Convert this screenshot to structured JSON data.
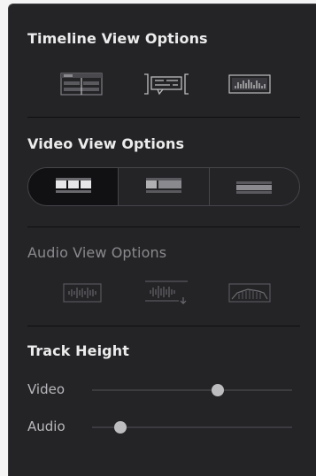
{
  "timeline_view": {
    "title": "Timeline View Options",
    "buttons": [
      {
        "icon": "stacked-timelines-icon"
      },
      {
        "icon": "subtitle-track-icon"
      },
      {
        "icon": "audio-waveform-track-icon"
      }
    ]
  },
  "video_view": {
    "title": "Video View Options",
    "options": [
      {
        "icon": "filmstrip-view-icon",
        "active": true
      },
      {
        "icon": "thumbnail-view-icon",
        "active": false
      },
      {
        "icon": "simple-view-icon",
        "active": false
      }
    ]
  },
  "audio_view": {
    "title": "Audio View Options",
    "buttons": [
      {
        "icon": "audio-waveform-icon"
      },
      {
        "icon": "audio-waveform-level-icon"
      },
      {
        "icon": "audio-envelope-icon"
      }
    ]
  },
  "track_height": {
    "title": "Track Height",
    "video": {
      "label": "Video",
      "value": 0.63
    },
    "audio": {
      "label": "Audio",
      "value": 0.14
    }
  },
  "colors": {
    "panel_bg": "#242427",
    "active_segment_bg": "#111113",
    "text_primary": "#ececec",
    "text_dim": "#8a8a8e",
    "icon": "#9a9a9e"
  }
}
